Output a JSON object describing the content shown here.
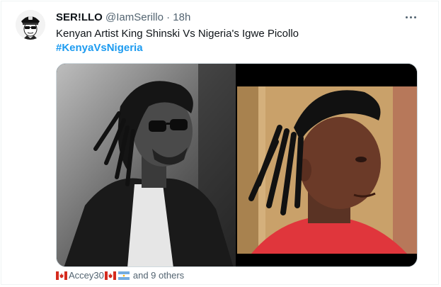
{
  "tweet": {
    "display_name": "SER!LLO",
    "handle": "@IamSerillo",
    "separator": "·",
    "time": "18h",
    "text": "Kenyan Artist King Shinski Vs Nigeria's Igwe Picollo",
    "hashtag": "#KenyaVsNigeria",
    "liked_by_user": "Accey30",
    "liked_by_suffix": "and 9 others"
  },
  "icons": {
    "more": "more-horizontal-icon",
    "flag_left": "canada-flag-icon",
    "flag_right": "argentina-flag-icon"
  },
  "colors": {
    "link": "#1d9bf0",
    "secondary_text": "#536471",
    "primary_text": "#0f1419"
  }
}
